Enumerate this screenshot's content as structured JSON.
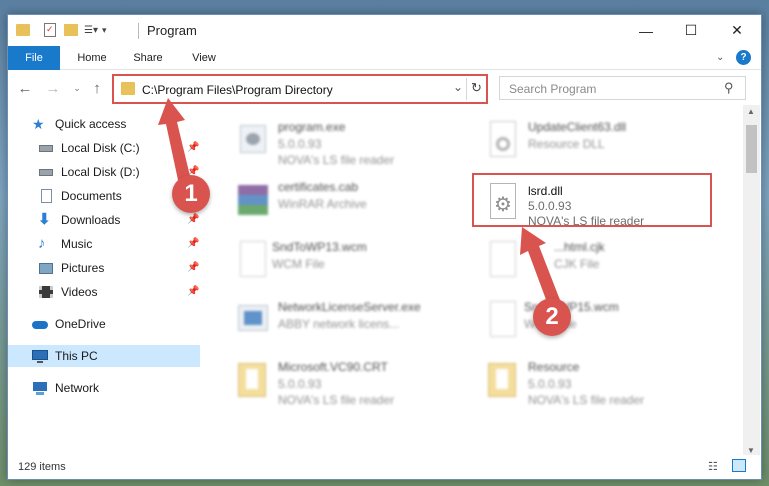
{
  "window": {
    "title": "Program",
    "minimize_glyph": "—",
    "maximize_glyph": "☐",
    "close_glyph": "✕"
  },
  "ribbon": {
    "tabs": [
      "File",
      "Home",
      "Share",
      "View"
    ],
    "help_glyph": "?"
  },
  "address": {
    "path": "C:\\Program Files\\Program Directory",
    "search_placeholder": "Search Program"
  },
  "sidebar": {
    "items": [
      {
        "label": "Quick access",
        "icon": "star-icon"
      },
      {
        "label": "Local Disk (C:)",
        "icon": "drive-icon",
        "pinned": true
      },
      {
        "label": "Local Disk (D:)",
        "icon": "drive-icon",
        "pinned": true
      },
      {
        "label": "Documents",
        "icon": "documents-icon",
        "pinned": true
      },
      {
        "label": "Downloads",
        "icon": "download-icon",
        "pinned": true
      },
      {
        "label": "Music",
        "icon": "music-icon",
        "pinned": true
      },
      {
        "label": "Pictures",
        "icon": "pictures-icon",
        "pinned": true
      },
      {
        "label": "Videos",
        "icon": "videos-icon",
        "pinned": true
      },
      {
        "label": "OneDrive",
        "icon": "cloud-icon"
      },
      {
        "label": "This PC",
        "icon": "computer-icon",
        "selected": true
      },
      {
        "label": "Network",
        "icon": "network-icon"
      }
    ]
  },
  "files": [
    {
      "name": "program.exe",
      "version": "5.0.0.93",
      "description": "NOVA's LS file reader",
      "icon": "exe-icon"
    },
    {
      "name": "UpdateClient63.dll",
      "version": "",
      "description": "Resource DLL",
      "icon": "dll-icon"
    },
    {
      "name": "certificates.cab",
      "version": "",
      "description": "WinRAR Archive",
      "icon": "archive-icon"
    },
    {
      "name": "lsrd.dll",
      "version": "5.0.0.93",
      "description": "NOVA's LS file reader",
      "icon": "dll-gear-icon"
    },
    {
      "name": "SndToWP13.wcm",
      "version": "",
      "description": "WCM File",
      "icon": "file-icon"
    },
    {
      "name": "...html.cjk",
      "version": "",
      "description": "CJK File",
      "icon": "file-icon"
    },
    {
      "name": "NetworkLicenseServer.exe",
      "version": "",
      "description": "ABBY network licens...",
      "icon": "exe-blue-icon"
    },
    {
      "name": "SndToWP15.wcm",
      "version": "",
      "description": "WCM File",
      "icon": "file-icon"
    },
    {
      "name": "Microsoft.VC90.CRT",
      "version": "5.0.0.93",
      "description": "NOVA's LS file reader",
      "icon": "folder-doc-icon"
    },
    {
      "name": "Resource",
      "version": "5.0.0.93",
      "description": "NOVA's LS file reader",
      "icon": "folder-doc-icon"
    }
  ],
  "status": {
    "item_count": "129 items"
  },
  "annotations": {
    "step1": "1",
    "step2": "2",
    "color": "#d9534f"
  }
}
